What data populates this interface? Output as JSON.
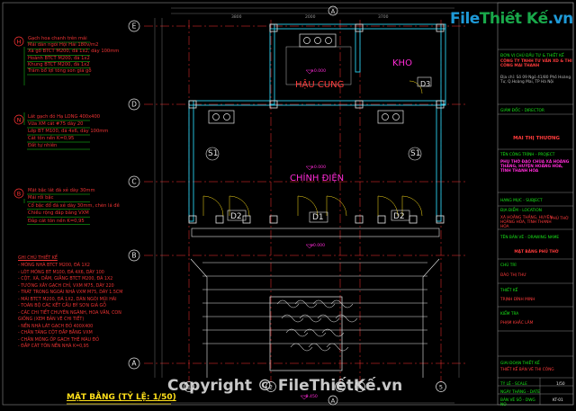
{
  "grid": {
    "rows": [
      "E",
      "D",
      "C",
      "B",
      "A"
    ],
    "cols": [
      "1",
      "2",
      "3",
      "4",
      "5"
    ]
  },
  "dims_top": [
    "3800",
    "2000",
    "3700"
  ],
  "section_marks": [
    "A",
    "A"
  ],
  "rooms": {
    "hau_cung": "HẬU CUNG",
    "kho": "KHO",
    "chinh_dien": "CHÍNH ĐIỆN"
  },
  "doors": [
    "D1",
    "D2",
    "D2",
    "D3"
  ],
  "windows": [
    "S1",
    "S1"
  ],
  "levels": [
    "±0.000",
    "±0.000",
    "±0.000",
    "-0.450"
  ],
  "legend": [
    {
      "marker": "H",
      "lines": [
        "Gạch hoa chanh trên mái",
        "Mái dán ngói Hội Hải 180v/m2",
        "Xà gồ BTCT M200, đá 1x2, dày 100mm",
        "Hoành BTCT M200, đá 1x2",
        "Khung BTCT M200, đá 1x2",
        "Trám bổ lợi tông son giả gỗ"
      ]
    },
    {
      "marker": "N",
      "lines": [
        "Lát gạch đỏ Hạ LONG 400x400",
        "Vữa XM cát #75 dày 20",
        "Lớp BT M100, đá 4x6, dày 100mm",
        "Cát tôn nền K=0,95",
        "Đất tự nhiên"
      ]
    },
    {
      "marker": "B",
      "lines": [
        "Mặt bậc lát đá xẻ dày 30mm",
        "Mái rối bậc",
        "Cổ bậc đổ đá xẻ dày 30mm, chèn lá đề",
        "Chiều rộng đắp bằng VXM",
        "Đắp cát tôn nền K=0,95"
      ]
    }
  ],
  "notes": {
    "title": "GHI CHÚ THIẾT KẾ",
    "items": [
      "- MÓNG NHÀ BTCT M200, ĐÁ 1X2",
      "- LÓT MÓNG BT M100, ĐÁ 4X6, DÀY 100",
      "- CỘT, XÀ, DẦM, GIẰNG BTCT M200, ĐÁ 1X2",
      "- TƯỜNG XÂY GẠCH CHỈ, VXM M75, DÀY 220",
      "- TRÁT TRONG NGOÀI NHÀ VXM M75, DÀY 1.5CM",
      "- MÁI BTCT M200, ĐÁ 1X2, DÁN NGÓI MŨI HÀI",
      "- TOÀN BỘ CÁC KẾT CẤU BÝ SƠN GIẢ GỖ",
      "- CÁC CHI TIẾT CHUYÊN NGÀNH, HOA VĂN, CON",
      "  GIỐNG (XEM BẢN VẼ CHI TIẾT)",
      "- NỀN NHÀ LÁT GẠCH ĐỎ 400X400",
      "- CHÂN TẢNG CỘT ĐẮP BẰNG VXM",
      "- CHÂN MÓNG ỐP GẠCH THẺ MÀU ĐỎ",
      "- ĐẮP CÁT TÔN NỀN NHÀ K=0,95"
    ]
  },
  "plan_title": "MẶT BẰNG (TỶ LỆ: 1/50)",
  "watermark": {
    "brand_file": "File",
    "brand_rest": "Thiết Kế",
    "brand_tld": ".vn",
    "copyright": "Copyright © FileThiếtKế.vn"
  },
  "title_block": {
    "company_label": "ĐƠN VỊ CHỦ ĐẦU TƯ & THIẾT KẾ",
    "company": "CÔNG TY TNHH TƯ VẤN XD & THI CÔNG MAI THANH",
    "address": "Địa chỉ: Số 09 Ngõ 41/80 Phố Hoàng Tư, Q.Hoàng Mai, TP Hà Nội",
    "director_label": "GIÁM ĐỐC - DIRECTOR",
    "director": "MAI THỊ THƯƠNG",
    "project_label": "TÊN CÔNG TRÌNH - PROJECT",
    "project": "PHỤ THỜ ĐẠO CHÙA XÃ HOÀNG THẮNG, HUYỆN HOẰNG HÓA, TỈNH THANH HÓA",
    "item_label": "HẠNG MỤC - SUBJECT",
    "item": "PHỦ THỜ",
    "location_label": "ĐỊA ĐIỂM - LOCATION",
    "location": "XÃ HOẰNG THẮNG, HUYỆN HOẰNG HÓA, TỈNH THANH HÓA",
    "drawing_label": "TÊN BẢN VẼ - DRAWING NAME",
    "drawing": "MẶT BẰNG PHỦ THỜ",
    "chair_label": "CHỦ TRÌ",
    "chair": "ĐÀO THỊ THƯ",
    "design_label": "THIẾT KẾ",
    "design": "TRỊNH ĐÌNH MINH",
    "check_label": "KIỂM TRA",
    "check": "PHẠM KHẮC LÂM",
    "phase_label": "GIAI ĐOẠN THIẾT KẾ",
    "phase": "THIẾT KẾ BẢN VẼ THI CÔNG",
    "scale_label": "TỶ LỆ - SCALE",
    "scale": "1/50",
    "date_label": "NGÀY THÁNG - DATE",
    "sheet_label": "BẢN VẼ SỐ - DWG NO",
    "sheet": "KT-01"
  }
}
